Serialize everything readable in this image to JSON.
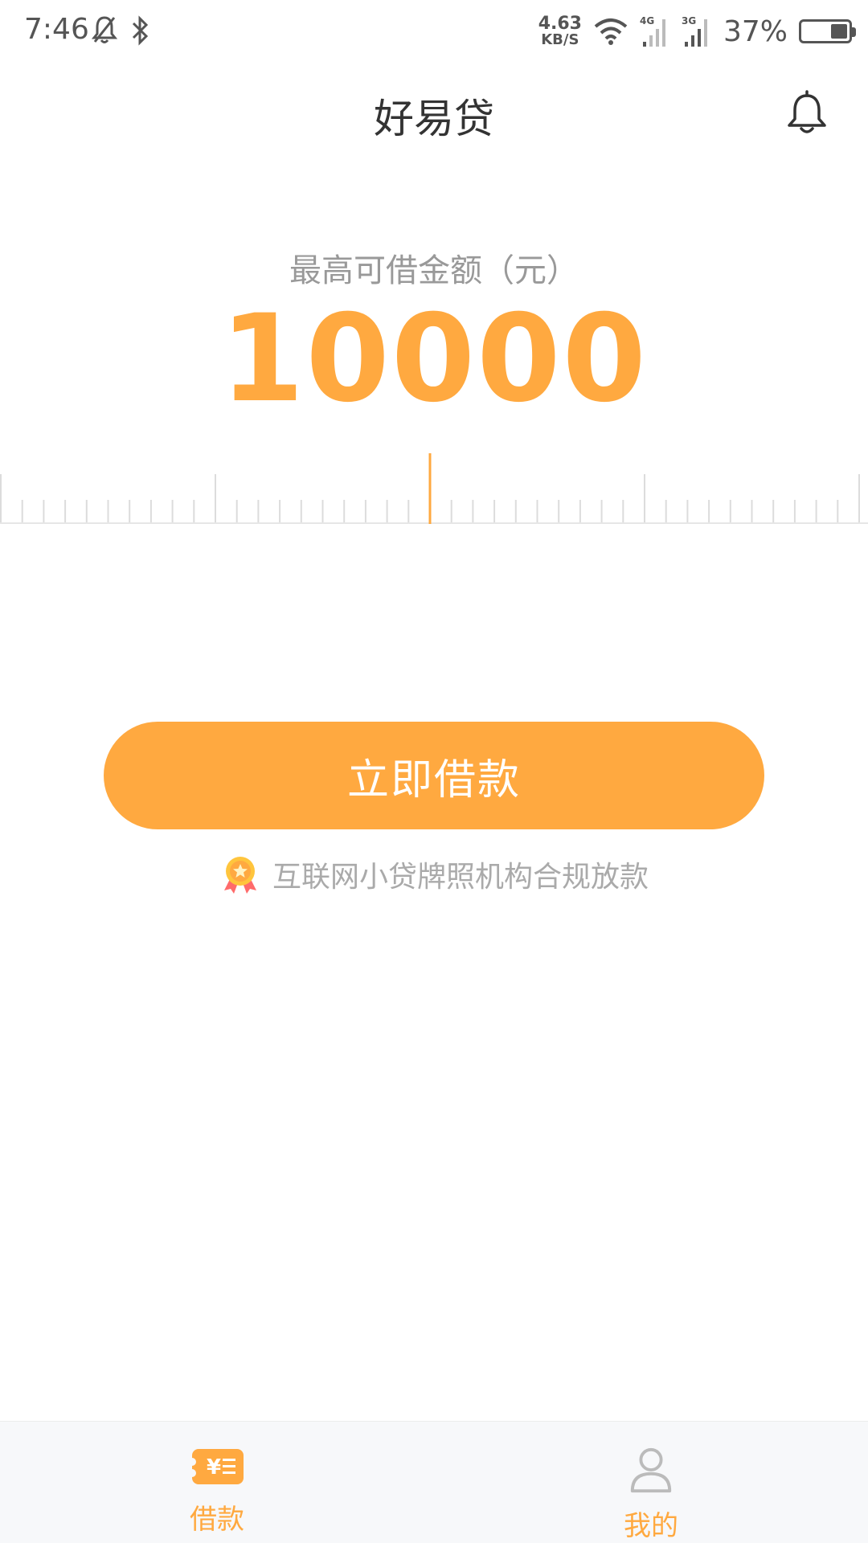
{
  "status_bar": {
    "time": "7:46",
    "net_speed_value": "4.63",
    "net_speed_unit": "KB/S",
    "network_4g": "4G",
    "network_3g": "3G",
    "battery_percent": "37%",
    "battery_level": 0.37
  },
  "header": {
    "title": "好易贷"
  },
  "loan": {
    "amount_label": "最高可借金额（元）",
    "amount_value": "10000"
  },
  "actions": {
    "borrow_button": "立即借款",
    "notice": "互联网小贷牌照机构合规放款"
  },
  "nav": {
    "items": [
      {
        "label": "借款",
        "icon": "loan-icon",
        "active": true
      },
      {
        "label": "我的",
        "icon": "user-icon",
        "active": false
      }
    ]
  },
  "colors": {
    "accent": "#ffa940",
    "text_gray": "#999999",
    "title": "#333333"
  }
}
